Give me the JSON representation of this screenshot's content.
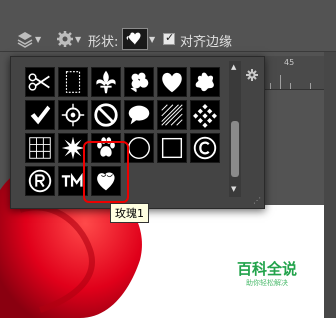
{
  "options_bar": {
    "shape_label": "形状:",
    "align_edges_label": "对齐边缘",
    "align_edges_checked": true
  },
  "ruler": {
    "number": "45"
  },
  "shape_picker": {
    "shapes": [
      "scissors-shape",
      "blank-card-shape",
      "fleur-de-lis-shape",
      "flower-bunch-shape",
      "heart-shape",
      "splat-shape",
      "checkmark-shape",
      "crosshair-shape",
      "no-symbol-shape",
      "speech-bubble-shape",
      "diagonal-lines-shape",
      "checkerboard-shape",
      "grid-shape",
      "burst-shape",
      "paw-print-shape",
      "circle-frame-shape",
      "square-frame-shape",
      "copyright-shape",
      "registered-shape",
      "trademark-shape",
      "rose-heart-shape"
    ],
    "selected": "rose-heart-shape"
  },
  "tooltip": {
    "text": "玫瑰1"
  },
  "watermark": {
    "main": "百科全说",
    "sub": "助你轻松解决"
  },
  "colors": {
    "accent_red": "#e00000",
    "watermark_green": "#22a34b",
    "tooltip_bg": "#ffffe1"
  }
}
